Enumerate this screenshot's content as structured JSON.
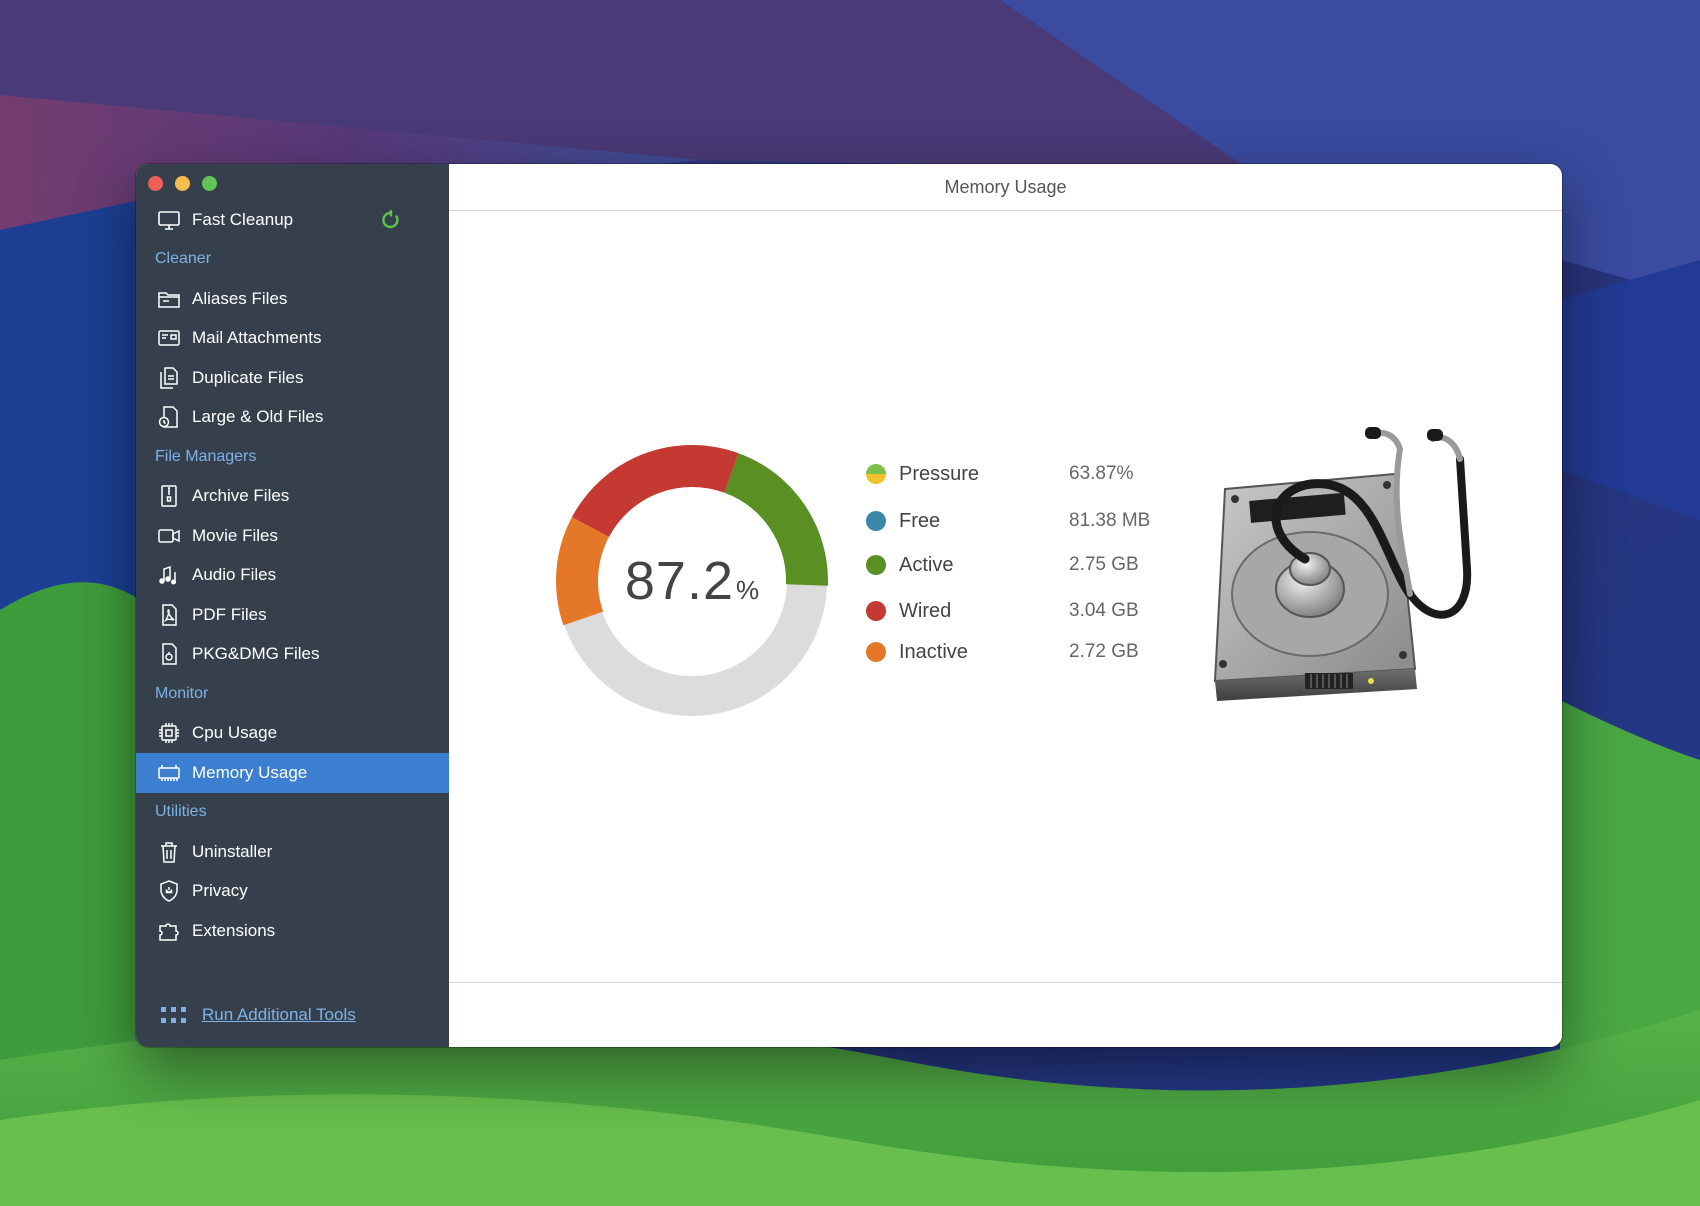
{
  "window": {
    "title": "Memory Usage"
  },
  "sidebar": {
    "top_item": {
      "label": "Fast Cleanup",
      "icon": "monitor-icon",
      "status_icon": "refresh-icon"
    },
    "sections": [
      {
        "label": "Cleaner",
        "items": [
          {
            "label": "Aliases Files",
            "icon": "alias-folder-icon"
          },
          {
            "label": "Mail Attachments",
            "icon": "mail-attachment-icon"
          },
          {
            "label": "Duplicate Files",
            "icon": "duplicate-files-icon"
          },
          {
            "label": "Large & Old Files",
            "icon": "large-old-files-icon"
          }
        ]
      },
      {
        "label": "File Managers",
        "items": [
          {
            "label": "Archive Files",
            "icon": "archive-icon"
          },
          {
            "label": "Movie Files",
            "icon": "movie-icon"
          },
          {
            "label": "Audio Files",
            "icon": "audio-icon"
          },
          {
            "label": "PDF Files",
            "icon": "pdf-icon"
          },
          {
            "label": "PKG&DMG Files",
            "icon": "package-icon"
          }
        ]
      },
      {
        "label": "Monitor",
        "items": [
          {
            "label": "Cpu Usage",
            "icon": "cpu-icon"
          },
          {
            "label": "Memory Usage",
            "icon": "memory-icon",
            "active": true
          }
        ]
      },
      {
        "label": "Utilities",
        "items": [
          {
            "label": "Uninstaller",
            "icon": "trash-icon"
          },
          {
            "label": "Privacy",
            "icon": "shield-icon"
          },
          {
            "label": "Extensions",
            "icon": "extensions-icon"
          }
        ]
      }
    ],
    "run_tools_label": "Run Additional Tools"
  },
  "memory": {
    "usage_value": "87.2",
    "usage_unit": "%",
    "legend": [
      {
        "label": "Pressure",
        "value": "63.87%",
        "color": "#f2c12e",
        "color2": "#7cc04b"
      },
      {
        "label": "Free",
        "value": "81.38 MB",
        "color": "#3a87a8"
      },
      {
        "label": "Active",
        "value": "2.75 GB",
        "color": "#5a8f23"
      },
      {
        "label": "Wired",
        "value": "3.04 GB",
        "color": "#c43a32"
      },
      {
        "label": "Inactive",
        "value": "2.72 GB",
        "color": "#e57828"
      }
    ]
  },
  "colors": {
    "sidebar_bg": "#36404d",
    "active_item_bg": "#3c7fd1",
    "section_label": "#7eb2e6",
    "donut_track": "#dcdcdc"
  }
}
